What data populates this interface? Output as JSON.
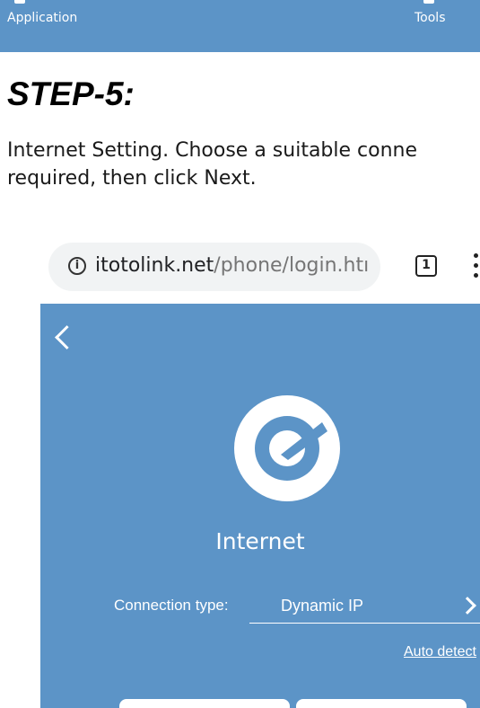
{
  "top_bar": {
    "left_label": "Application",
    "right_label": "Tools"
  },
  "step_heading": "STEP-5:",
  "description": {
    "line1": "Internet Setting. Choose a suitable conne",
    "line2": "required, then click Next."
  },
  "browser": {
    "url_host": "itotolink.net",
    "url_path": "/phone/login.htı",
    "tab_count": "1"
  },
  "page": {
    "title": "Internet",
    "connection_label": "Connection type:",
    "connection_value": "Dynamic IP",
    "auto_detect": "Auto detect"
  },
  "colors": {
    "panel_blue": "#5c94c7",
    "url_bar": "#f1f3f4"
  }
}
